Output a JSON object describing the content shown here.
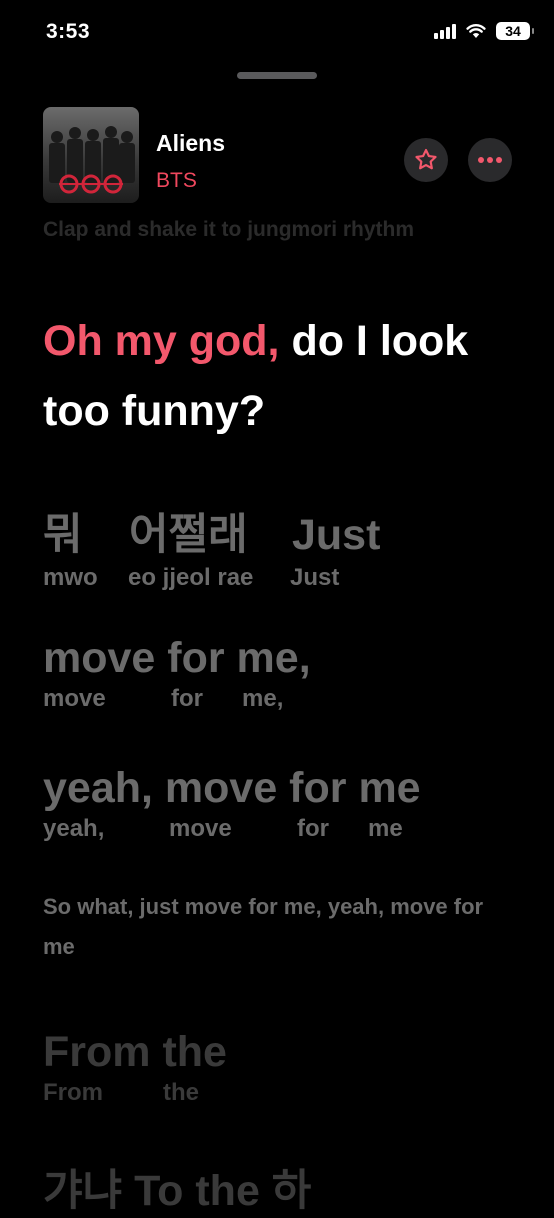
{
  "status_bar": {
    "time": "3:53",
    "battery": "34"
  },
  "now_playing": {
    "title": "Aliens",
    "artist": "BTS"
  },
  "lyrics": {
    "previous_line": "Clap and shake it to jungmori rhythm",
    "current": {
      "sung": "Oh my god,",
      "rest": " do I look too funny?"
    },
    "line1": {
      "words": [
        "뭐",
        "어쩔래",
        "Just"
      ],
      "roman": [
        "mwo",
        "eo jjeol rae",
        "Just"
      ]
    },
    "line2": {
      "words": [
        "move for me,"
      ],
      "roman": [
        "move",
        "for",
        "me,"
      ]
    },
    "line3": {
      "words": [
        "yeah, move for me"
      ],
      "roman": [
        "yeah,",
        "move",
        "for",
        "me"
      ]
    },
    "line4": "So what, just move for me, yeah, move for me",
    "line5": {
      "words": [
        "From the"
      ],
      "roman": [
        "From",
        "the"
      ]
    },
    "line6": "갸냐 To the 하"
  },
  "colors": {
    "accent": "#f3586c",
    "inactive": "#6b6b6b",
    "background": "#000000"
  },
  "icons": [
    "wifi-icon",
    "signal-icon",
    "battery-icon",
    "star-icon",
    "more-icon"
  ]
}
